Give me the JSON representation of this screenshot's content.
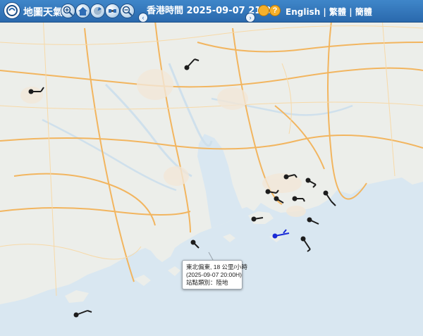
{
  "app": {
    "title": "地圖天氣"
  },
  "toolbar": {
    "time_label": "香港時間 2025-09-07 21:00",
    "prev_arrow": "‹",
    "next_arrow": "›",
    "help_label": "?",
    "lang_english": "English",
    "lang_sep": " | ",
    "lang_trad": "繁體",
    "lang_simp": "簡體",
    "icons": [
      "zoom-in-icon",
      "home-icon",
      "radar-icon",
      "satellite-icon",
      "zoom-out-icon",
      "sun-icon",
      "help-icon"
    ]
  },
  "popup": {
    "line1": "東北偏東, 18 公里/小時",
    "line2": "(2025-09-07 20:00H)",
    "line3": "站點類別：陸地"
  },
  "colors": {
    "sea": "#dfeaf2",
    "land": "#eceeea",
    "road": "#f2b55f",
    "barb": "#1d1d1d",
    "selected": "#1a2bd6"
  }
}
